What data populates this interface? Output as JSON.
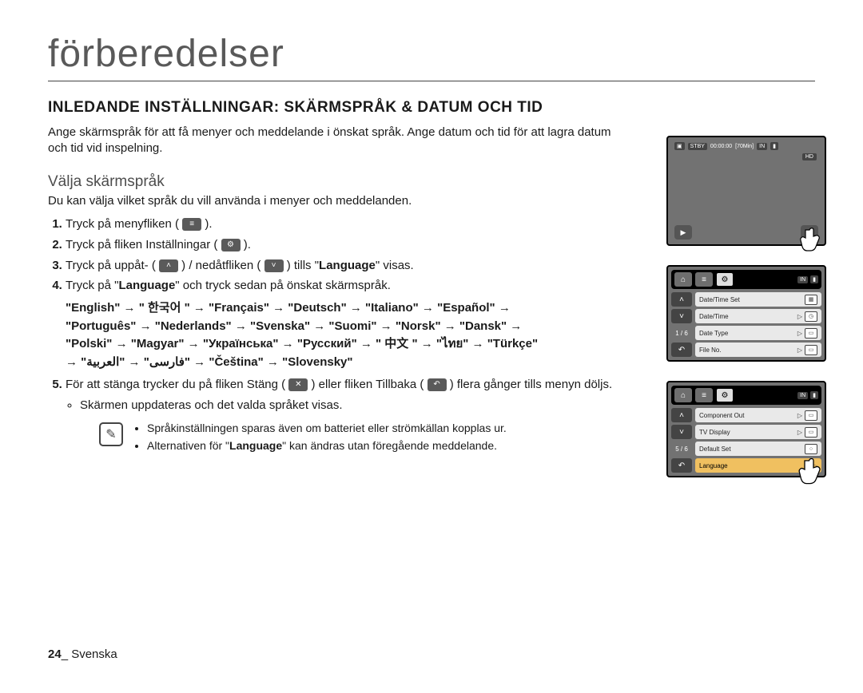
{
  "title": "förberedelser",
  "sectionHeading": "INLEDANDE INSTÄLLNINGAR: SKÄRMSPRÅK & DATUM OCH TID",
  "intro": "Ange skärmspråk för att få menyer och meddelande i önskat språk. Ange datum och tid för att lagra datum och tid vid inspelning.",
  "subheading": "Välja skärmspråk",
  "subtext": "Du kan välja vilket språk du vill använda i menyer och meddelanden.",
  "steps": {
    "s1_a": "Tryck på menyfliken ( ",
    "s1_b": " ).",
    "s2_a": "Tryck på fliken Inställningar ( ",
    "s2_b": " ).",
    "s3_a": "Tryck på uppåt- ( ",
    "s3_b": " ) / nedåtfliken ( ",
    "s3_c": " ) tills \"",
    "s3_lang": "Language",
    "s3_d": "\" visas.",
    "s4_a": "Tryck på \"",
    "s4_lang": "Language",
    "s4_b": "\" och tryck sedan på önskat skärmspråk.",
    "s5_a": "För att stänga trycker du på fliken Stäng ( ",
    "s5_b": " ) eller fliken Tillbaka ( ",
    "s5_c": " ) flera gånger tills menyn döljs.",
    "bullet1": "Skärmen uppdateras och det valda språket visas."
  },
  "languages": {
    "row1": "\"English\" → \" 한국어 \" → \"Français\" → \"Deutsch\" → \"Italiano\" → \"Español\" →",
    "row2": "\"Português\" → \"Nederlands\" → \"Svenska\" → \"Suomi\" → \"Norsk\" → \"Dansk\" →",
    "row3": "\"Polski\" → \"Magyar\" → \"Українська\" → \"Русский\" → \" 中文 \" → \"ไทย\" → \"Türkçe\"",
    "row4": "→ \"ﻓﺎرسی\" → \"العربية\" → \"Čeština\" → \"Slovensky\""
  },
  "notes": {
    "n1": "Språkinställningen sparas även om batteriet eller strömkällan kopplas ur.",
    "n2a": "Alternativen för \"",
    "n2lang": "Language",
    "n2b": "\" kan ändras utan föregående meddelande."
  },
  "footer": {
    "page": "24",
    "sep": "_ ",
    "lang": "Svenska"
  },
  "screen1": {
    "stby": "STBY",
    "time": "00:00:00",
    "remain": "[70Min]",
    "in": "IN",
    "hd": "HD"
  },
  "screen2": {
    "page": "1 / 6",
    "rows": [
      "Date/Time Set",
      "Date/Time",
      "Date Type",
      "File No."
    ]
  },
  "screen3": {
    "page": "5 / 6",
    "rows": [
      "Component Out",
      "TV Display",
      "Default Set",
      "Language"
    ]
  }
}
